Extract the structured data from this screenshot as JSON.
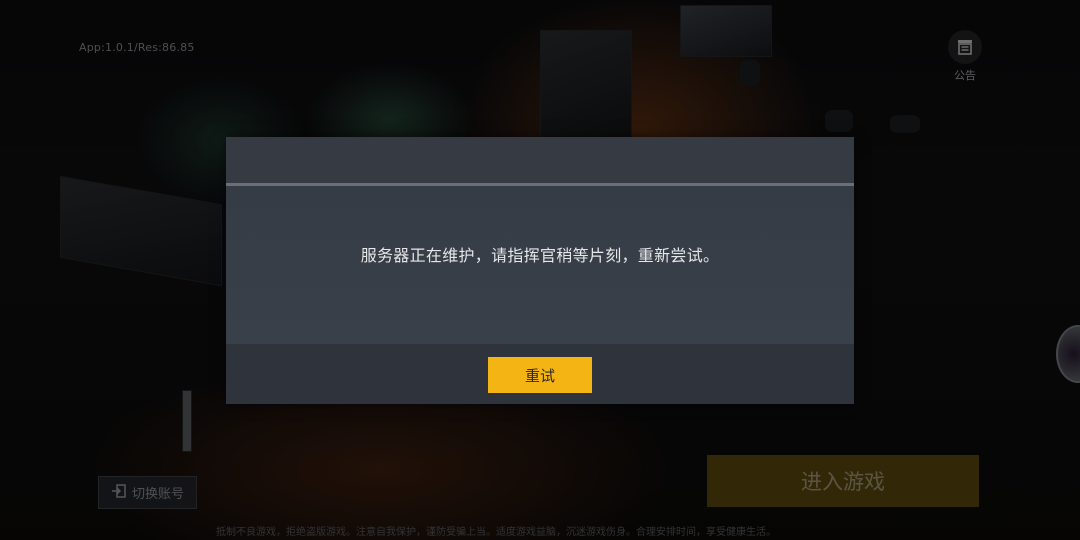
{
  "app_version": "App:1.0.1/Res:86.85",
  "notice": {
    "label": "公告",
    "icon": "notice-board-icon"
  },
  "switch_account": {
    "label": "切换账号",
    "icon": "logout-icon"
  },
  "enter_game": {
    "label": "进入游戏"
  },
  "health_notice": "抵制不良游戏，拒绝盗版游戏。注意自我保护，谨防受骗上当。适度游戏益脑，沉迷游戏伤身。合理安排时间，享受健康生活。",
  "dialog": {
    "message": "服务器正在维护，请指挥官稍等片刻，重新尝试。",
    "retry_label": "重试"
  },
  "colors": {
    "retry_button": "#f4b414",
    "dialog_background": "#353a43",
    "enter_game_button": "#5b4a10"
  }
}
